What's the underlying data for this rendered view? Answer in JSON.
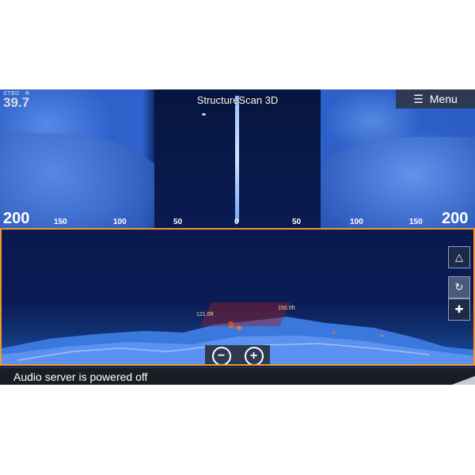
{
  "app": {
    "title": "StructureScan 3D",
    "menu_label": "Menu"
  },
  "depth": {
    "label": "STBD",
    "label2": "R",
    "value": "39.7"
  },
  "range_scale": {
    "left_max": "200",
    "right_max": "200",
    "ticks": [
      "150",
      "100",
      "50",
      "0",
      "50",
      "100",
      "150"
    ]
  },
  "view3d": {
    "markers": [
      "121.0ft",
      "150.0ft"
    ],
    "zoom_out_symbol": "−",
    "zoom_in_symbol": "+"
  },
  "status": {
    "message": "Audio server is powered off"
  },
  "colors": {
    "accent": "#f0962a",
    "water": "#0a1c49",
    "sonar": "#2b5fc7"
  }
}
